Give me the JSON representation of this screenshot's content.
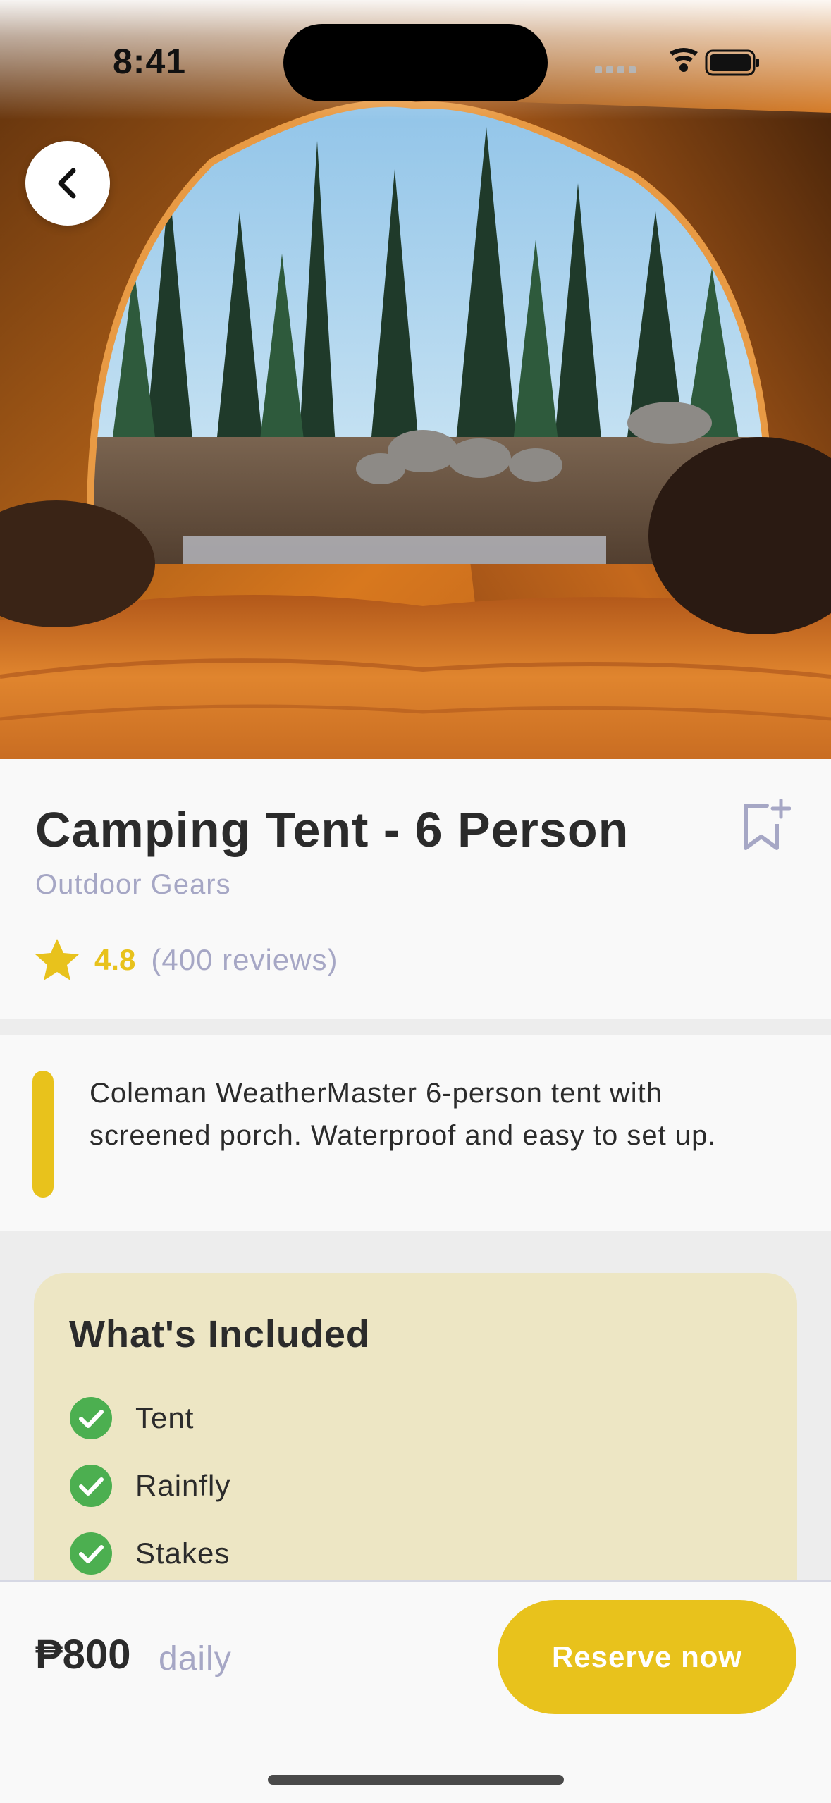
{
  "status_bar": {
    "time": "8:41"
  },
  "product": {
    "title": "Camping Tent - 6 Person",
    "category": "Outdoor Gears",
    "rating": "4.8",
    "reviews": "(400 reviews)",
    "description": "Coleman WeatherMaster 6-person tent with screened porch. Waterproof and easy to set up."
  },
  "included": {
    "title": "What's Included",
    "items": [
      "Tent",
      "Rainfly",
      "Stakes"
    ]
  },
  "booking": {
    "price": "₱800",
    "period": "daily",
    "reserve_label": "Reserve now"
  },
  "colors": {
    "accent": "#e8c21c",
    "muted": "#a6a7c5",
    "check": "#4caf50",
    "included_bg": "#ede6c4"
  },
  "icons": {
    "back": "chevron-left-icon",
    "bookmark": "bookmark-add-icon",
    "star": "star-icon",
    "check": "check-circle-icon"
  }
}
